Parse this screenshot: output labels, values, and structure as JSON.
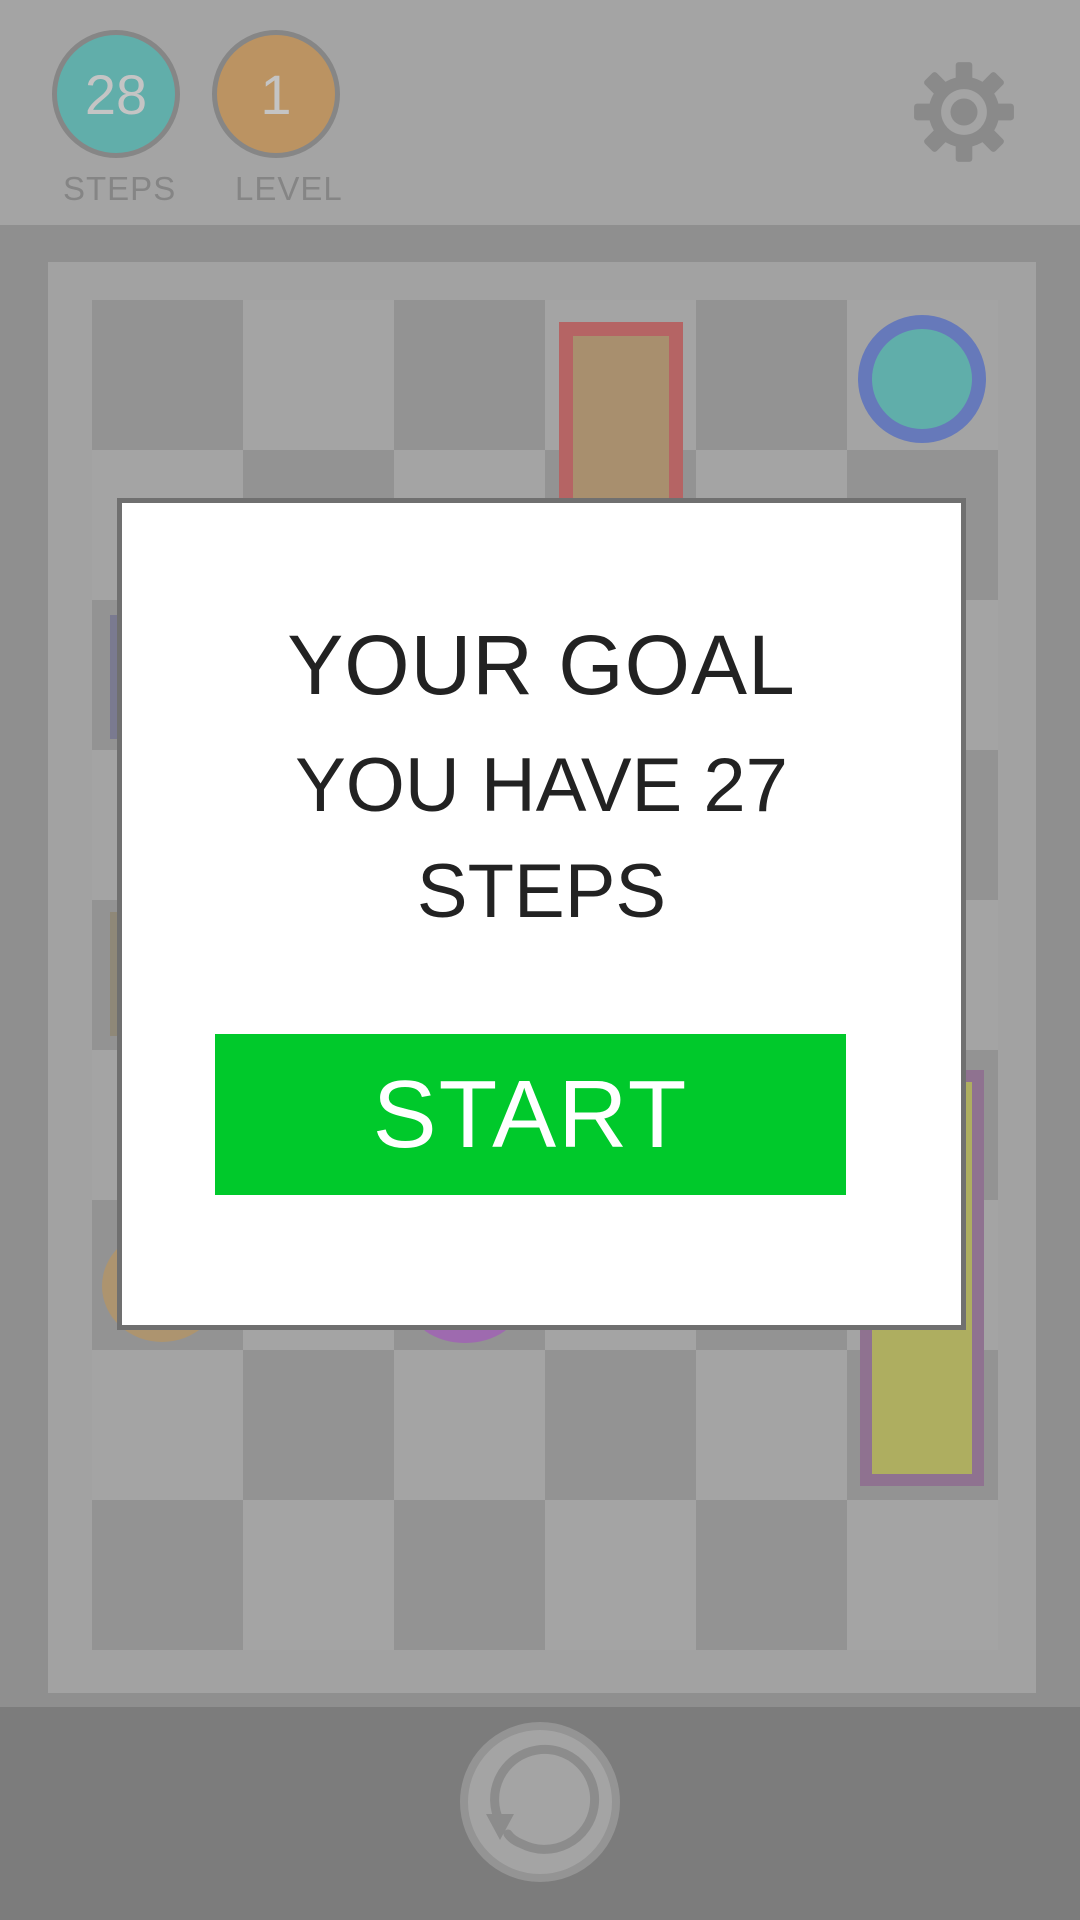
{
  "header": {
    "steps": {
      "value": "28",
      "label": "STEPS",
      "color": "#61aeaa"
    },
    "level": {
      "value": "1",
      "label": "LEVEL",
      "color": "#bb9362"
    },
    "settings_icon": "gear-icon"
  },
  "board": {
    "light_color": "#a4a4a4",
    "dark_color": "#939393",
    "pieces": [
      {
        "name": "red-bordered-block",
        "fill": "#a88f6e",
        "border": "#b56464"
      },
      {
        "name": "teal-ball",
        "fill": "#60aeaa",
        "border": "#6679ba"
      },
      {
        "name": "yellow-block",
        "fill": "#aeae60",
        "border": "#8f7290"
      }
    ]
  },
  "dialog": {
    "title": "YOUR GOAL",
    "line1": "YOU HAVE 27",
    "line2": "STEPS",
    "start_label": "START",
    "start_color": "#00c92b"
  },
  "footer": {
    "reset_icon": "reset-icon"
  }
}
